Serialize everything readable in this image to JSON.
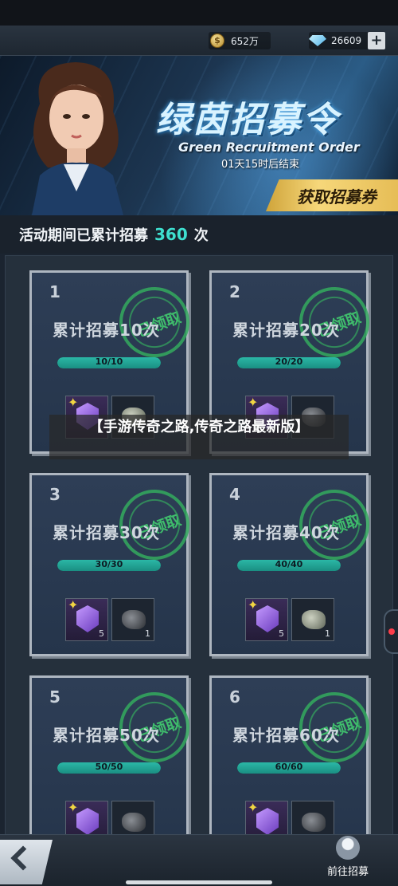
{
  "header": {
    "coins": "652万",
    "gems": "26609",
    "plus_label": "+"
  },
  "banner": {
    "title": "绿茵招募令",
    "subtitle": "Green Recruitment Order",
    "countdown": "01天15时后结束",
    "cta": "获取招募券"
  },
  "tally": {
    "prefix": "活动期间已累计招募",
    "count": "360",
    "suffix": "次"
  },
  "cards": [
    {
      "num": "1",
      "title": "累计招募10次",
      "progress": "10/10",
      "fraction": 1.0,
      "claimed": "已领取",
      "reward1_count": "",
      "reward2_count": ""
    },
    {
      "num": "2",
      "title": "累计招募20次",
      "progress": "20/20",
      "fraction": 1.0,
      "claimed": "已领取",
      "reward1_count": "",
      "reward2_count": ""
    },
    {
      "num": "3",
      "title": "累计招募30次",
      "progress": "30/30",
      "fraction": 1.0,
      "claimed": "已领取",
      "reward1_count": "5",
      "reward2_count": "1"
    },
    {
      "num": "4",
      "title": "累计招募40次",
      "progress": "40/40",
      "fraction": 1.0,
      "claimed": "已领取",
      "reward1_count": "5",
      "reward2_count": "1"
    },
    {
      "num": "5",
      "title": "累计招募50次",
      "progress": "50/50",
      "fraction": 1.0,
      "claimed": "已领取",
      "reward1_count": "",
      "reward2_count": ""
    },
    {
      "num": "6",
      "title": "累计招募60次",
      "progress": "60/60",
      "fraction": 1.0,
      "claimed": "已领取",
      "reward1_count": "",
      "reward2_count": ""
    }
  ],
  "overlay": {
    "text": "【手游传奇之路,传奇之路最新版】"
  },
  "footer": {
    "goto_label": "前往招募"
  },
  "colors": {
    "accent": "#3ee0d0",
    "progress": "#2bb7a6",
    "stamp": "#34aa5e",
    "cta": "#f6d77a"
  },
  "icons": [
    "coin-icon",
    "diamond-icon",
    "plus-icon",
    "badge-icon",
    "item-icon",
    "back-arrow-icon",
    "recruit-icon"
  ]
}
